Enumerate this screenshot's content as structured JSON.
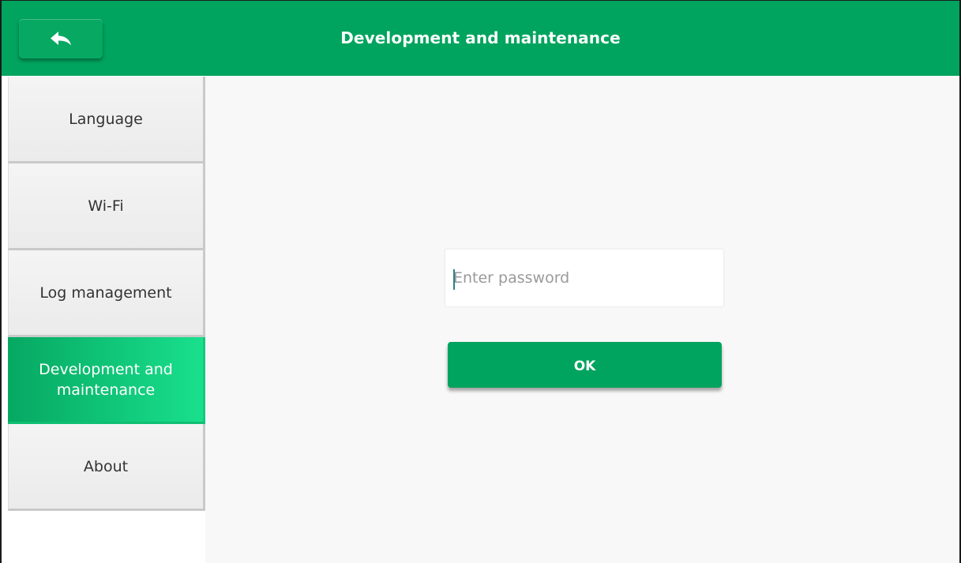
{
  "header": {
    "title": "Development and maintenance",
    "back_icon": "back-arrow-icon",
    "background_color": "#00a45e"
  },
  "sidebar": {
    "active_index": 3,
    "items": [
      {
        "label": "Language"
      },
      {
        "label": "Wi-Fi"
      },
      {
        "label": "Log management"
      },
      {
        "label": "Development and maintenance"
      },
      {
        "label": "About"
      }
    ],
    "active_color": "#19e08c"
  },
  "form": {
    "password": {
      "value": "",
      "placeholder": "Enter password"
    },
    "ok_label": "OK"
  }
}
